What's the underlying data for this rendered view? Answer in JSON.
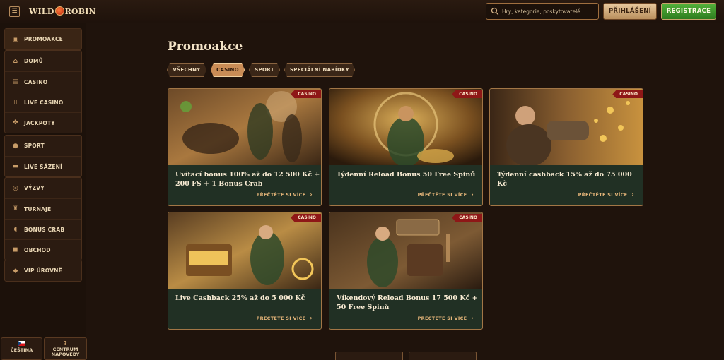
{
  "header": {
    "logo_text_1": "WILD",
    "logo_text_2": "ROBIN",
    "search_placeholder": "Hry, kategorie, poskytovatelé",
    "login_label": "PŘIHLÁŠENÍ",
    "register_label": "REGISTRACE"
  },
  "sidebar": {
    "items": [
      {
        "label": "PROMOAKCE",
        "icon": "gift-icon"
      },
      {
        "label": "DOMŮ",
        "icon": "home-icon"
      },
      {
        "label": "CASINO",
        "icon": "slot-icon"
      },
      {
        "label": "LIVE CASINO",
        "icon": "cards-icon"
      },
      {
        "label": "JACKPOTY",
        "icon": "clover-icon"
      },
      {
        "label": "SPORT",
        "icon": "ball-icon"
      },
      {
        "label": "LIVE SÁZENÍ",
        "icon": "live-icon"
      },
      {
        "label": "VÝZVY",
        "icon": "target-icon"
      },
      {
        "label": "TURNAJE",
        "icon": "trophy-icon"
      },
      {
        "label": "BONUS CRAB",
        "icon": "crab-icon"
      },
      {
        "label": "OBCHOD",
        "icon": "bag-icon"
      },
      {
        "label": "VIP ÚROVNĚ",
        "icon": "diamond-icon"
      }
    ],
    "language_label": "ČEŠTINA",
    "help_label_1": "CENTRUM",
    "help_label_2": "NÁPOVĚDY"
  },
  "main": {
    "title": "Promoakce",
    "filters": [
      "VŠECHNY",
      "CASINO",
      "SPORT",
      "SPECIÁLNÍ NABÍDKY"
    ],
    "active_filter": "CASINO",
    "read_more": "PŘEČTĚTE SI VÍCE",
    "cards": [
      {
        "tag": "CASINO",
        "title": "Uvítací bonus 100% až do 12 500 Kč + 200 FS + 1 Bonus Crab"
      },
      {
        "tag": "CASINO",
        "title": "Týdenní Reload Bonus 50 Free Spinů"
      },
      {
        "tag": "CASINO",
        "title": "Týdenní cashback 15% až do 75 000 Kč"
      },
      {
        "tag": "CASINO",
        "title": "Live Cashback 25% až do 5 000 Kč"
      },
      {
        "tag": "CASINO",
        "title": "Víkendový Reload Bonus 17 500 Kč + 50 Free Spinů"
      }
    ]
  },
  "colors": {
    "accent": "#c98c56",
    "register_green": "#3f9a2c",
    "tag_red": "#8e1717",
    "card_bg": "#213024"
  }
}
